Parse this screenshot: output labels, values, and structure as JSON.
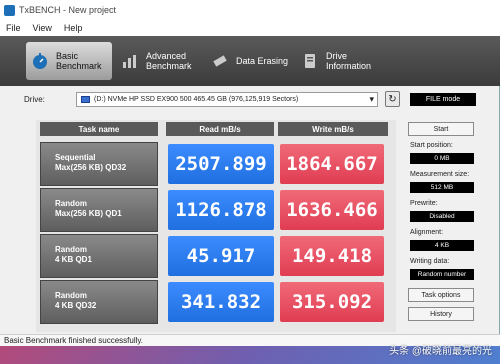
{
  "window": {
    "title": "TxBENCH - New project"
  },
  "menu": [
    "File",
    "View",
    "Help"
  ],
  "tabs": [
    {
      "label_line1": "Basic",
      "label_line2": "Benchmark",
      "icon": "stopwatch-icon",
      "active": true
    },
    {
      "label_line1": "Advanced",
      "label_line2": "Benchmark",
      "icon": "bar-chart-icon",
      "active": false
    },
    {
      "label_line1": "Data Erasing",
      "label_line2": "",
      "icon": "eraser-icon",
      "active": false
    },
    {
      "label_line1": "Drive",
      "label_line2": "Information",
      "icon": "info-icon",
      "active": false
    }
  ],
  "drive": {
    "label": "Drive:",
    "selected": "(D:) NVMe HP SSD EX900 500  465.45 GB (976,125,919 Sectors)",
    "file_mode_label": "FILE mode"
  },
  "table": {
    "headers": {
      "task": "Task name",
      "read": "Read mB/s",
      "write": "Write mB/s"
    },
    "rows": [
      {
        "line1": "Sequential",
        "line2": "Max(256 KB) QD32",
        "read": "2507.899",
        "write": "1864.667"
      },
      {
        "line1": "Random",
        "line2": "Max(256 KB) QD1",
        "read": "1126.878",
        "write": "1636.466"
      },
      {
        "line1": "Random",
        "line2": "4 KB QD1",
        "read": "45.917",
        "write": "149.418"
      },
      {
        "line1": "Random",
        "line2": "4 KB QD32",
        "read": "341.832",
        "write": "315.092"
      }
    ]
  },
  "side": {
    "start_label": "Start",
    "start_position_label": "Start position:",
    "start_position_value": "0 MB",
    "measurement_size_label": "Measurement size:",
    "measurement_size_value": "512 MB",
    "prewrite_label": "Prewrite:",
    "prewrite_value": "Disabled",
    "alignment_label": "Alignment:",
    "alignment_value": "4 KB",
    "writing_data_label": "Writing data:",
    "writing_data_value": "Random number",
    "task_options_label": "Task options",
    "history_label": "History"
  },
  "status": {
    "text": "Basic Benchmark finished successfully."
  },
  "watermark": "头条 @破晓前最亮的光",
  "colors": {
    "read": "#2a7cf0",
    "write": "#e84c5e"
  }
}
